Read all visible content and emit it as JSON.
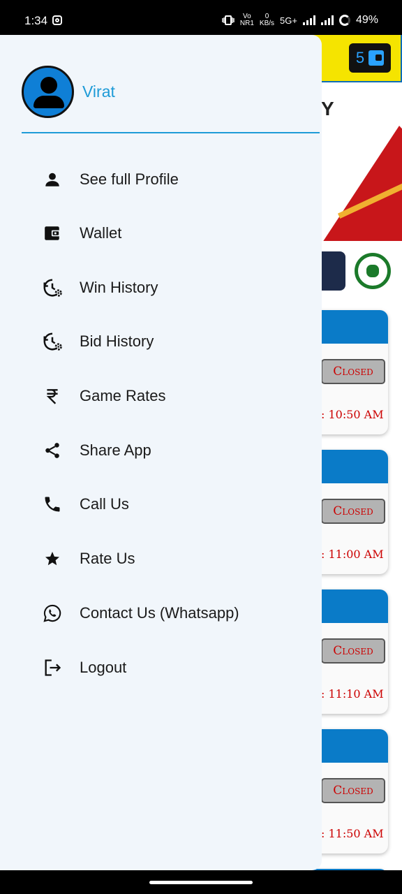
{
  "status_bar": {
    "time": "1:34",
    "network": "5G+",
    "net_speed_value": "0",
    "net_speed_unit": "KB/s",
    "volte_top": "Vo",
    "volte_bottom": "NR1",
    "battery": "49%"
  },
  "app": {
    "wallet_balance": "5",
    "cards": [
      {
        "status": "Closed",
        "time": ": 10:50 AM"
      },
      {
        "status": "Closed",
        "time": ": 11:00 AM"
      },
      {
        "status": "Closed",
        "time": ": 11:10 AM"
      },
      {
        "status": "Closed",
        "time": ": 11:50 AM"
      }
    ],
    "banner_letter": "Y"
  },
  "drawer": {
    "username": "Virat",
    "items": [
      {
        "label": "See full Profile",
        "icon": "person-icon"
      },
      {
        "label": "Wallet",
        "icon": "wallet-icon"
      },
      {
        "label": "Win History",
        "icon": "history-settings-icon"
      },
      {
        "label": "Bid History",
        "icon": "history-settings-icon"
      },
      {
        "label": "Game Rates",
        "icon": "rupee-icon"
      },
      {
        "label": "Share App",
        "icon": "share-icon"
      },
      {
        "label": "Call Us",
        "icon": "phone-icon"
      },
      {
        "label": "Rate Us",
        "icon": "star-icon"
      },
      {
        "label": "Contact Us (Whatsapp)",
        "icon": "whatsapp-icon"
      },
      {
        "label": "Logout",
        "icon": "logout-icon"
      }
    ]
  },
  "colors": {
    "accent": "#1e9bd7",
    "drawer_bg": "#f1f6fb",
    "card_header": "#0a7bc8",
    "closed_text": "#cc0000",
    "topbar": "#f5e400"
  }
}
